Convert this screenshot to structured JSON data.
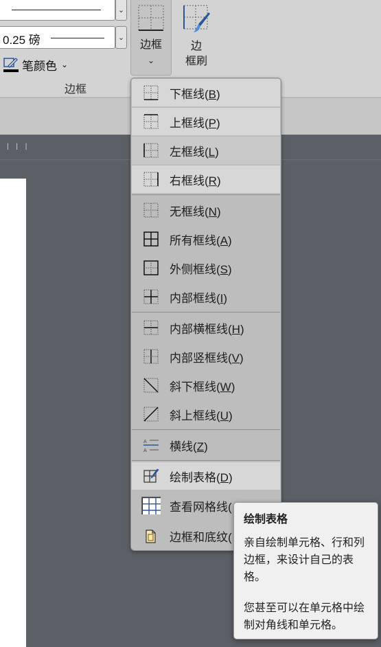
{
  "ribbon": {
    "line_weight": "0.25 磅",
    "pen_color_label": "笔颜色",
    "borders_button_label": "边框",
    "border_painter_label_line1": "边",
    "border_painter_label_line2": "框刷",
    "group_label": "边框",
    "accent_color": "#2b579a"
  },
  "menu": {
    "items": [
      {
        "label": "下框线(",
        "key": "B",
        "close": ")",
        "icon": "bottom-border-icon"
      },
      {
        "label": "上框线(",
        "key": "P",
        "close": ")",
        "icon": "top-border-icon"
      },
      {
        "label": "左框线(",
        "key": "L",
        "close": ")",
        "icon": "left-border-icon"
      },
      {
        "label": "右框线(",
        "key": "R",
        "close": ")",
        "icon": "right-border-icon"
      },
      {
        "label": "无框线(",
        "key": "N",
        "close": ")",
        "icon": "no-border-icon"
      },
      {
        "label": "所有框线(",
        "key": "A",
        "close": ")",
        "icon": "all-borders-icon"
      },
      {
        "label": "外侧框线(",
        "key": "S",
        "close": ")",
        "icon": "outside-borders-icon"
      },
      {
        "label": "内部框线(",
        "key": "I",
        "close": ")",
        "icon": "inside-borders-icon"
      },
      {
        "label": "内部横框线(",
        "key": "H",
        "close": ")",
        "icon": "inside-horizontal-border-icon"
      },
      {
        "label": "内部竖框线(",
        "key": "V",
        "close": ")",
        "icon": "inside-vertical-border-icon"
      },
      {
        "label": "斜下框线(",
        "key": "W",
        "close": ")",
        "icon": "diagonal-down-border-icon"
      },
      {
        "label": "斜上框线(",
        "key": "U",
        "close": ")",
        "icon": "diagonal-up-border-icon"
      },
      {
        "label": "横线(",
        "key": "Z",
        "close": ")",
        "icon": "horizontal-line-icon"
      },
      {
        "label": "绘制表格(",
        "key": "D",
        "close": ")",
        "icon": "draw-table-icon"
      },
      {
        "label": "查看网格线(",
        "key": "",
        "close": "",
        "icon": "view-gridlines-icon"
      },
      {
        "label": "边框和底纹(",
        "key": "",
        "close": "",
        "icon": "borders-and-shading-icon"
      }
    ]
  },
  "tooltip": {
    "title": "绘制表格",
    "body": "亲自绘制单元格、行和列边框，来设计自己的表格。",
    "body2": "您甚至可以在单元格中绘制对角线和单元格。"
  }
}
